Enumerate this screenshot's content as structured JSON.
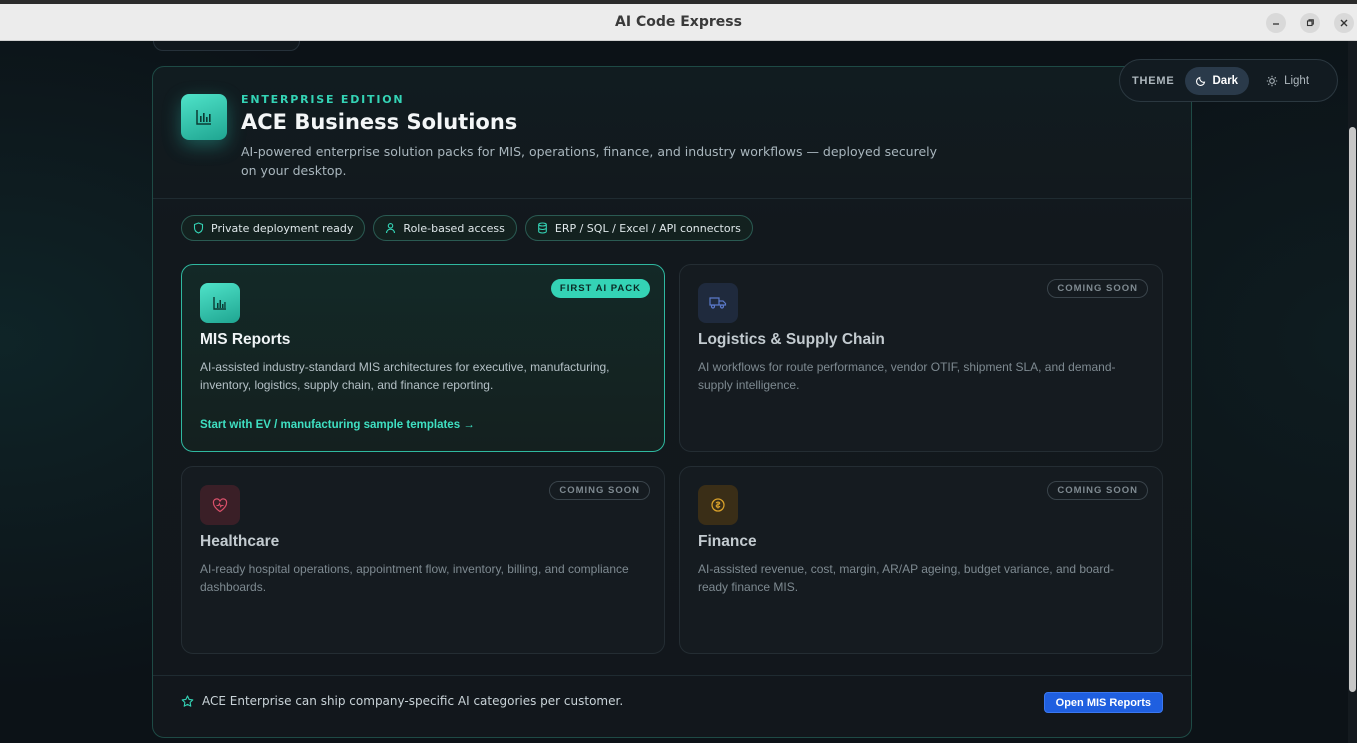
{
  "window": {
    "title": "AI Code Express"
  },
  "theme": {
    "label": "THEME",
    "dark_label": "Dark",
    "light_label": "Light",
    "selected": "Dark"
  },
  "header": {
    "eyebrow": "ENTERPRISE EDITION",
    "title": "ACE Business Solutions",
    "subtitle": "AI-powered enterprise solution packs for MIS, operations, finance, and industry workflows — deployed securely on your desktop."
  },
  "chips": [
    {
      "label": "Private deployment ready",
      "icon": "shield-icon"
    },
    {
      "label": "Role-based access",
      "icon": "user-icon"
    },
    {
      "label": "ERP / SQL / Excel / API connectors",
      "icon": "database-icon"
    }
  ],
  "cards": [
    {
      "title": "MIS Reports",
      "badge": "FIRST AI PACK",
      "description": "AI-assisted industry-standard MIS architectures for executive, manufacturing, inventory, logistics, supply chain, and finance reporting.",
      "link": "Start with EV / manufacturing sample templates →",
      "icon": "bar-chart-icon",
      "accent": "#34d3b5"
    },
    {
      "title": "Logistics & Supply Chain",
      "badge": "COMING SOON",
      "description": "AI workflows for route performance, vendor OTIF, shipment SLA, and demand-supply intelligence.",
      "icon": "truck-icon",
      "accent": "#5b79c9"
    },
    {
      "title": "Healthcare",
      "badge": "COMING SOON",
      "description": "AI-ready hospital operations, appointment flow, inventory, billing, and compliance dashboards.",
      "icon": "heart-pulse-icon",
      "accent": "#d9506a"
    },
    {
      "title": "Finance",
      "badge": "COMING SOON",
      "description": "AI-assisted revenue, cost, margin, AR/AP ageing, budget variance, and board-ready finance MIS.",
      "icon": "coin-icon",
      "accent": "#d9a12a"
    }
  ],
  "footer": {
    "text": "ACE Enterprise can ship company-specific AI categories per customer.",
    "button": "Open MIS Reports"
  }
}
